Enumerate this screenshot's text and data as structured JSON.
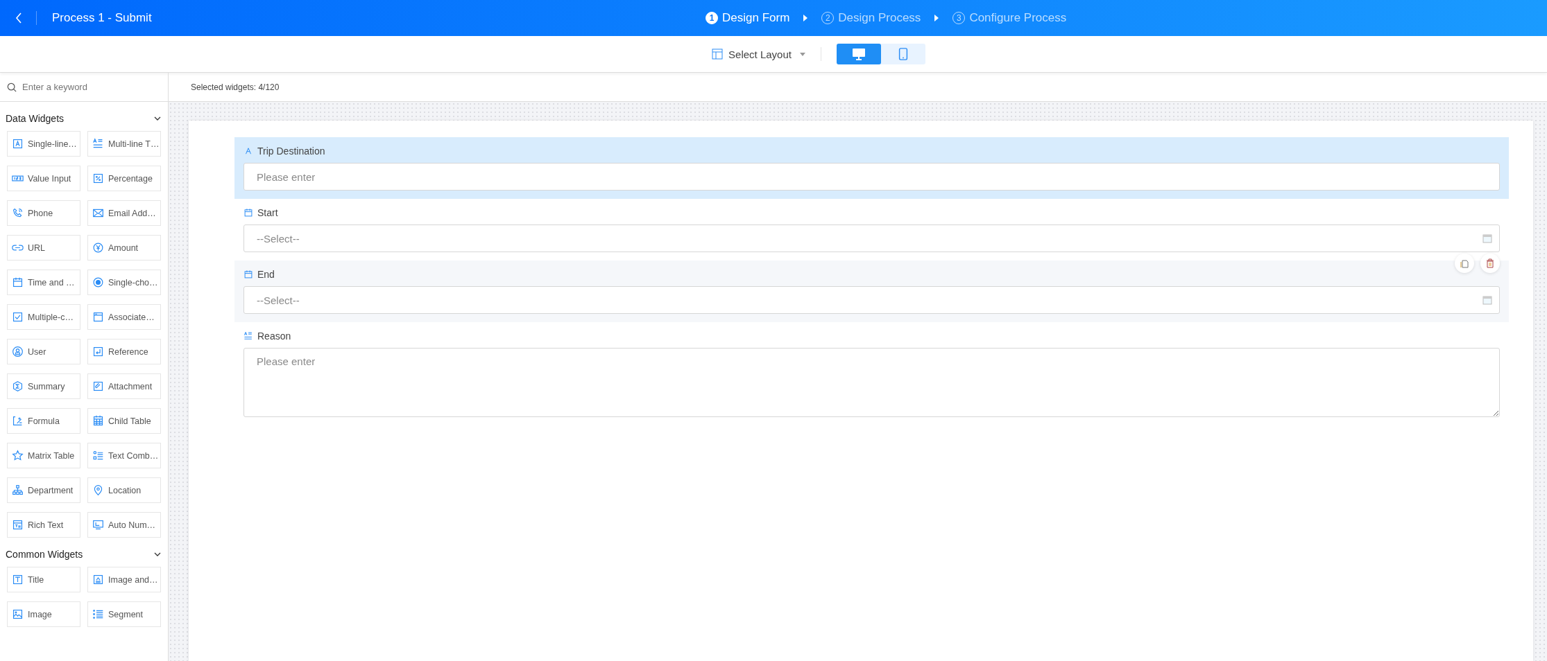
{
  "header": {
    "title": "Process 1 - Submit"
  },
  "steps": [
    {
      "number": "1",
      "label": "Design Form",
      "selected": true
    },
    {
      "number": "2",
      "label": "Design Process",
      "selected": false
    },
    {
      "number": "3",
      "label": "Configure Process",
      "selected": false
    }
  ],
  "toolbar": {
    "layout_label": "Select Layout",
    "views": [
      {
        "kind": "desktop",
        "selected": true
      },
      {
        "kind": "mobile",
        "selected": false
      }
    ]
  },
  "sidebar": {
    "search": {
      "placeholder": "Enter a keyword"
    },
    "sections": [
      {
        "title": "Data Widgets",
        "expanded": true,
        "widgets": [
          "Single-line…",
          "Multi-line T…",
          "Value Input",
          "Percentage",
          "Phone",
          "Email Add…",
          "URL",
          "Amount",
          "Time and …",
          "Single-cho…",
          "Multiple-c…",
          "Associate…",
          "User",
          "Reference",
          "Summary",
          "Attachment",
          "Formula",
          "Child Table",
          "Matrix Table",
          "Text Comb…",
          "Department",
          "Location",
          "Rich Text",
          "Auto Num…"
        ]
      },
      {
        "title": "Common Widgets",
        "expanded": true,
        "widgets": [
          "Title",
          "Image and…",
          "Image",
          "Segment"
        ]
      }
    ]
  },
  "canvas": {
    "counter": "Selected widgets: 4/120",
    "fields": [
      {
        "kind": "text",
        "label": "Trip Destination",
        "placeholder": "Please enter",
        "selected": true,
        "hovered": false
      },
      {
        "kind": "date",
        "label": "Start",
        "placeholder": "--Select--",
        "selected": false,
        "hovered": false
      },
      {
        "kind": "date",
        "label": "End",
        "placeholder": "--Select--",
        "selected": false,
        "hovered": true
      },
      {
        "kind": "textarea",
        "label": "Reason",
        "placeholder": "Please enter",
        "selected": false,
        "hovered": false
      }
    ]
  }
}
